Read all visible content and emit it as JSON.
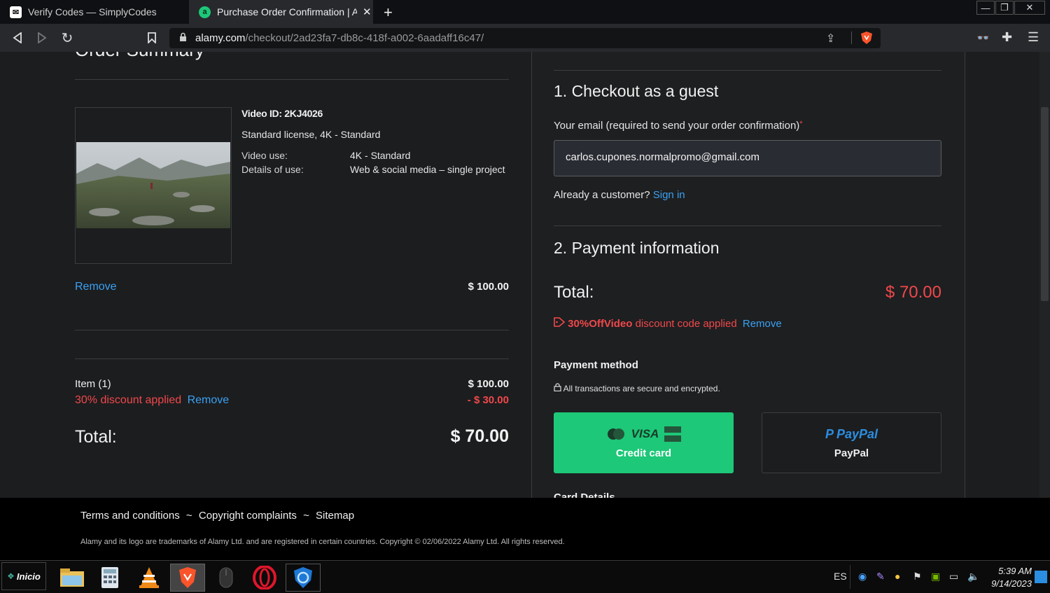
{
  "browser": {
    "tabs": [
      {
        "title": "Verify Codes — SimplyCodes"
      },
      {
        "title": "Purchase Order Confirmation | Ala"
      }
    ],
    "new_tab_glyph": "+",
    "url_domain": "alamy.com",
    "url_path": "/checkout/2ad23fa7-db8c-418f-a002-6aadaff16c47/",
    "icons": [
      "back-icon",
      "forward-icon",
      "reload-icon",
      "bookmark-icon",
      "lock-icon",
      "share-icon",
      "brave-shield-icon",
      "reader-icon",
      "extensions-icon",
      "menu-icon"
    ]
  },
  "order_summary": {
    "heading": "Order Summary",
    "video_id": "Video ID: 2KJ4026",
    "license": "Standard license, 4K - Standard",
    "video_use_label": "Video use:",
    "video_use_value": "4K - Standard",
    "details_label": "Details of use:",
    "details_value": "Web & social media – single project",
    "remove_label": "Remove",
    "item_price": "$ 100.00",
    "item_count_label": "Item (1)",
    "item_subtotal": "$ 100.00",
    "discount_label": "30% discount applied",
    "discount_remove": "Remove",
    "discount_value": "- $ 30.00",
    "total_label": "Total:",
    "total_value": "$ 70.00"
  },
  "checkout": {
    "step1_title": "1. Checkout as a guest",
    "email_label": "Your email (required to send your order confirmation)",
    "required_mark": "*",
    "email_value": "carlos.cupones.normalpromo@gmail.com",
    "already_customer": "Already a customer?",
    "sign_in": "Sign in",
    "step2_title": "2. Payment information",
    "total_label": "Total:",
    "total_value": "$ 70.00",
    "code_name": "30%OffVideo",
    "code_text": "discount code applied",
    "code_remove": "Remove",
    "payment_method_label": "Payment method",
    "secure_text": "All transactions are secure and encrypted.",
    "credit_card_label": "Credit card",
    "visa_text": "VISA",
    "paypal_logo_text": "PayPal",
    "paypal_label": "PayPal",
    "card_details_label": "Card Details"
  },
  "footer": {
    "links": [
      "Terms and conditions",
      "Copyright complaints",
      "Sitemap"
    ],
    "separator": "~",
    "copyright": "Alamy and its logo are trademarks of Alamy Ltd. and are registered in certain countries. Copyright © 02/06/2022 Alamy Ltd. All rights reserved."
  },
  "taskbar": {
    "start_label": "Inicio",
    "lang": "ES",
    "time": "5:39 AM",
    "date": "9/14/2023"
  },
  "colors": {
    "accent_green": "#1dc878",
    "link_blue": "#3aa1f2",
    "discount_red": "#f0484a"
  }
}
